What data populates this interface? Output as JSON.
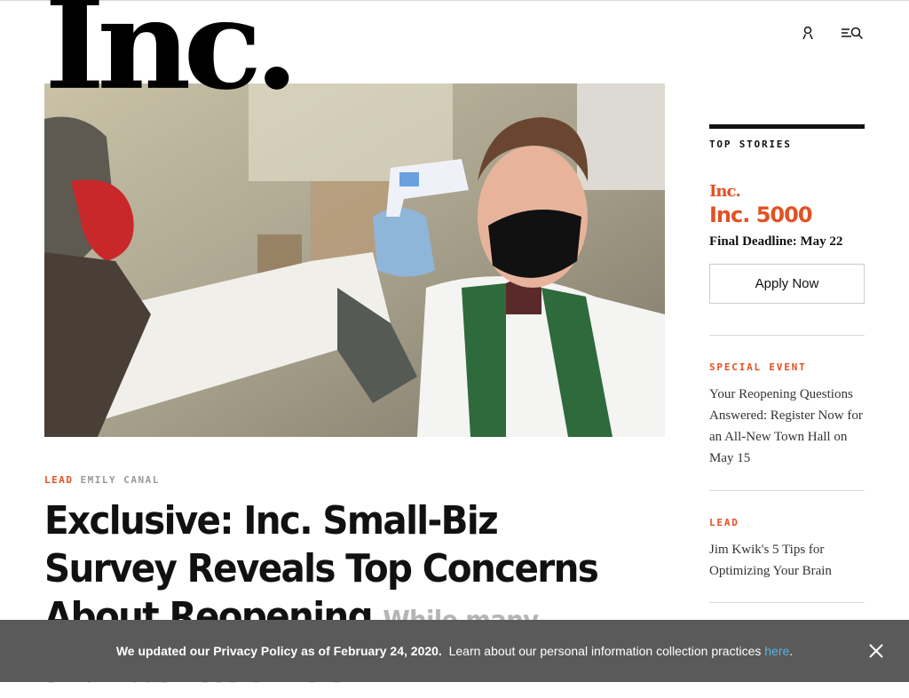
{
  "brand": {
    "logo_text": "Inc."
  },
  "header": {
    "account_icon": "user-icon",
    "menu_search_icon": "menu-search-icon"
  },
  "article": {
    "kicker": "LEAD",
    "author": "EMILY CANAL",
    "headline": "Exclusive: Inc. Small-Biz Survey Reveals Top Concerns About Reopening",
    "dek": "While many small-business owners"
  },
  "sidebar": {
    "title": "TOP STORIES",
    "promo": {
      "brand": "Inc.",
      "title": "Inc. 5000",
      "deadline": "Final Deadline: May 22",
      "button": "Apply Now"
    },
    "stories": [
      {
        "kicker": "SPECIAL EVENT",
        "title": "Your Reopening Questions Answered: Register Now for an All-New Town Hall on May 15"
      },
      {
        "kicker": "LEAD",
        "title": "Jim Kwik's 5 Tips for Optimizing Your Brain"
      }
    ]
  },
  "cookie_banner": {
    "bold_text": "We updated our Privacy Policy as of February 24, 2020.",
    "text": "Learn about our personal information collection practices",
    "link": "here",
    "end": "."
  },
  "colors": {
    "accent": "#e35123",
    "link": "#54b4e6",
    "banner": "#5a5a5a"
  }
}
